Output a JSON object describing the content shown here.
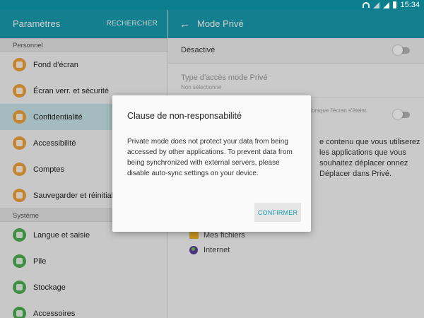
{
  "status_bar": {
    "time": "15:34"
  },
  "left_pane": {
    "title": "Paramètres",
    "search_label": "RECHERCHER",
    "sections": [
      {
        "title": "Personnel"
      },
      {
        "title": "Système"
      }
    ],
    "personal_items": [
      {
        "label": "Fond d'écran",
        "icon": "wallpaper-icon"
      },
      {
        "label": "Écran verr. et sécurité",
        "icon": "lock-screen-icon"
      },
      {
        "label": "Confidentialité",
        "icon": "privacy-icon",
        "selected": true
      },
      {
        "label": "Accessibilité",
        "icon": "accessibility-icon"
      },
      {
        "label": "Comptes",
        "icon": "accounts-key-icon"
      },
      {
        "label": "Sauvegarder et réinitialiser",
        "icon": "backup-icon"
      }
    ],
    "system_items": [
      {
        "label": "Langue et saisie",
        "icon": "language-icon"
      },
      {
        "label": "Pile",
        "icon": "battery-icon"
      },
      {
        "label": "Stockage",
        "icon": "storage-icon"
      },
      {
        "label": "Accessoires",
        "icon": "accessories-icon"
      }
    ]
  },
  "right_pane": {
    "title": "Mode Privé",
    "toggle_label": "Désactivé",
    "access_type_title": "Type d'accès mode Privé",
    "access_type_value": "Non sélectionné",
    "screen_off_text": "lorsque l'écran s'éteint.",
    "body_text": "e contenu que vous utiliserez les applications que vous souhaitez déplacer onnez Déplacer dans Privé.",
    "items": [
      {
        "label": "Mes fichiers",
        "icon": "folder-icon"
      },
      {
        "label": "Internet",
        "icon": "globe-icon"
      }
    ]
  },
  "dialog": {
    "title": "Clause de non-responsabilité",
    "message": "Private mode does not protect your data from being accessed by other applications. To prevent data from being synchronized with external servers, please disable auto-sync settings on your device.",
    "confirm_label": "CONFIRMER"
  },
  "colors": {
    "header": "#199daf",
    "status_bar": "#0c7f8e",
    "selected_row": "#c8e6ea",
    "accent_button_text": "#199daf"
  }
}
